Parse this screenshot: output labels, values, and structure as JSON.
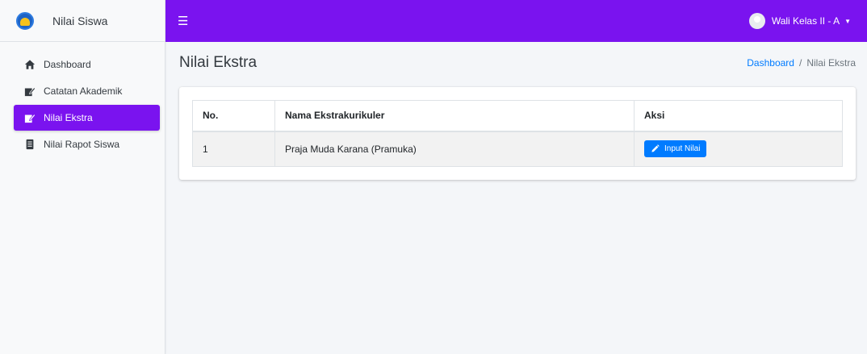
{
  "brand": {
    "name": "Nilai Siswa"
  },
  "sidebar": {
    "items": [
      {
        "label": "Dashboard",
        "icon": "home-icon",
        "active": false
      },
      {
        "label": "Catatan Akademik",
        "icon": "edit-icon",
        "active": false
      },
      {
        "label": "Nilai Ekstra",
        "icon": "edit-icon",
        "active": true
      },
      {
        "label": "Nilai Rapot Siswa",
        "icon": "book-icon",
        "active": false
      }
    ]
  },
  "topbar": {
    "menu_icon": "hamburger-icon",
    "user_name": "Wali Kelas II - A"
  },
  "page": {
    "title": "Nilai Ekstra",
    "breadcrumb": {
      "home": "Dashboard",
      "separator": "/",
      "current": "Nilai Ekstra"
    }
  },
  "table": {
    "headers": {
      "no": "No.",
      "nama": "Nama Ekstrakurikuler",
      "aksi": "Aksi"
    },
    "rows": [
      {
        "no": "1",
        "nama": "Praja Muda Karana (Pramuka)",
        "action_label": "Input Nilai"
      }
    ]
  },
  "colors": {
    "primary": "#7a13ef",
    "button": "#007bff"
  }
}
